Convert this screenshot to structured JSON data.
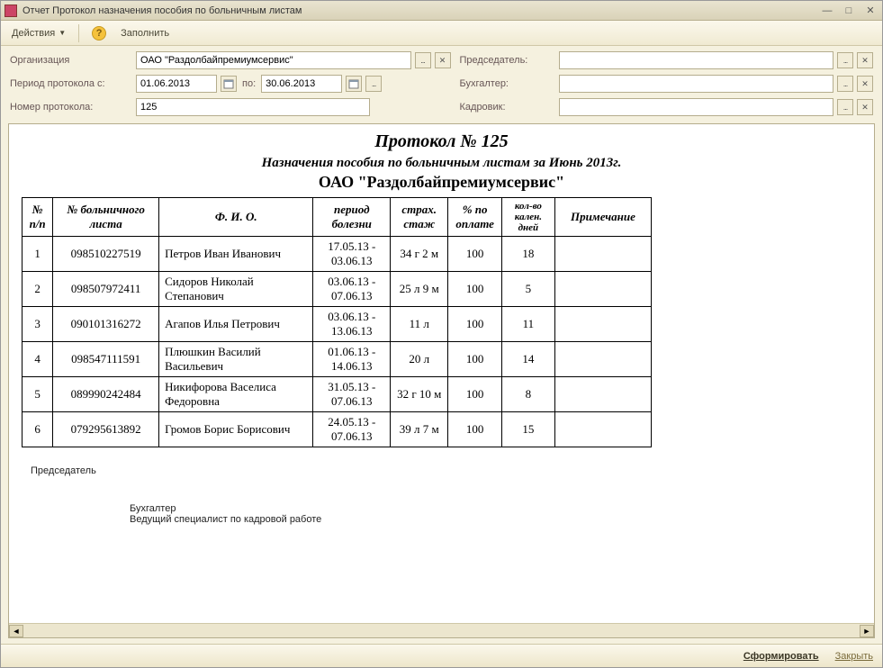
{
  "window": {
    "title": "Отчет  Протокол назначения пособия по больничным листам"
  },
  "toolbar": {
    "actions": "Действия",
    "fill": "Заполнить"
  },
  "form": {
    "org_label": "Организация",
    "org_value": "ОАО \"Раздолбайпремиумсервис\"",
    "period_label": "Период протокола с:",
    "date_from": "01.06.2013",
    "date_to_label": "по:",
    "date_to": "30.06.2013",
    "number_label": "Номер протокола:",
    "number_value": "125",
    "chairman_label": "Председатель:",
    "chairman_value": "",
    "accountant_label": "Бухгалтер:",
    "accountant_value": "",
    "hr_label": "Кадровик:",
    "hr_value": ""
  },
  "report": {
    "title": "Протокол № 125",
    "subtitle": "Назначения пособия по больничным листам за Июнь 2013г.",
    "org": "ОАО \"Раздолбайпремиумсервис\"",
    "columns": {
      "n": "№ п/п",
      "sheet": "№ больничного листа",
      "fio": "Ф. И. О.",
      "period": "период болезни",
      "stazh": "страх. стаж",
      "percent": "% по оплате",
      "days": "кол-во кален. дней",
      "note": "Примечание"
    },
    "rows": [
      {
        "n": "1",
        "sheet": "098510227519",
        "fio": "Петров Иван Иванович",
        "period": "17.05.13 - 03.06.13",
        "stazh": "34 г 2 м",
        "percent": "100",
        "days": "18",
        "note": ""
      },
      {
        "n": "2",
        "sheet": "098507972411",
        "fio": "Сидоров Николай Степанович",
        "period": "03.06.13 - 07.06.13",
        "stazh": "25 л 9 м",
        "percent": "100",
        "days": "5",
        "note": ""
      },
      {
        "n": "3",
        "sheet": "090101316272",
        "fio": "Агапов Илья Петрович",
        "period": "03.06.13 - 13.06.13",
        "stazh": "11 л",
        "percent": "100",
        "days": "11",
        "note": ""
      },
      {
        "n": "4",
        "sheet": "098547111591",
        "fio": "Плюшкин Василий Васильевич",
        "period": "01.06.13 - 14.06.13",
        "stazh": "20 л",
        "percent": "100",
        "days": "14",
        "note": ""
      },
      {
        "n": "5",
        "sheet": "089990242484",
        "fio": "Никифорова Васелиса Федоровна",
        "period": "31.05.13 - 07.06.13",
        "stazh": "32 г 10 м",
        "percent": "100",
        "days": "8",
        "note": ""
      },
      {
        "n": "6",
        "sheet": "079295613892",
        "fio": "Громов Борис Борисович",
        "period": "24.05.13 - 07.06.13",
        "stazh": "39 л 7 м",
        "percent": "100",
        "days": "15",
        "note": ""
      }
    ],
    "sign": {
      "chairman": "Председатель",
      "accountant": "Бухгалтер",
      "hr": "Ведущий  специалист по кадровой работе"
    }
  },
  "bottom": {
    "generate": "Сформировать",
    "close": "Закрыть"
  }
}
